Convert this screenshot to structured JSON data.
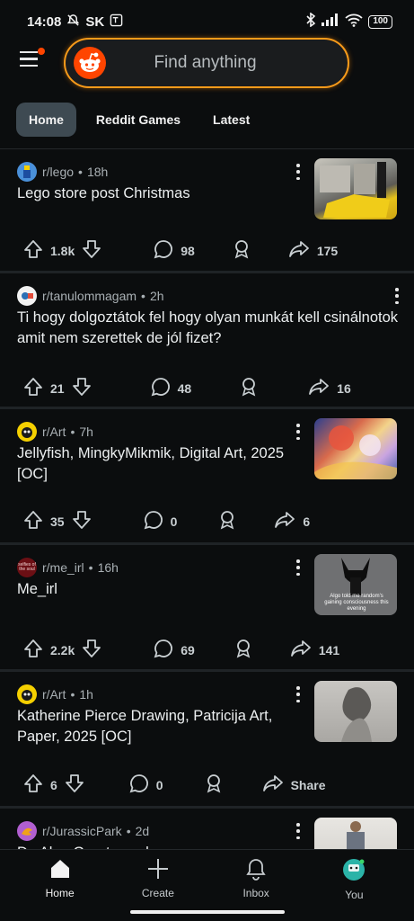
{
  "status": {
    "time": "14:08",
    "carrier": "SK",
    "battery": "100"
  },
  "search": {
    "placeholder": "Find anything"
  },
  "tabs": [
    "Home",
    "Reddit Games",
    "Latest"
  ],
  "posts": [
    {
      "subreddit": "r/lego",
      "age": "18h",
      "title": "Lego store post Christmas",
      "up": "1.8k",
      "comments": "98",
      "shares": "175"
    },
    {
      "subreddit": "r/tanulommagam",
      "age": "2h",
      "title": "Ti hogy dolgoztátok fel hogy olyan munkát kell csinálnotok amit nem szerettek de jól fizet?",
      "up": "21",
      "comments": "48",
      "shares": "16"
    },
    {
      "subreddit": "r/Art",
      "age": "7h",
      "title": "Jellyfish, MingkyMikmik, Digital Art, 2025 [OC]",
      "up": "35",
      "comments": "0",
      "shares": "6"
    },
    {
      "subreddit": "r/me_irl",
      "age": "16h",
      "title": "Me_irl",
      "up": "2.2k",
      "comments": "69",
      "shares": "141",
      "thumb_caption": "Algo told me random's gaining consciousness this evening"
    },
    {
      "subreddit": "r/Art",
      "age": "1h",
      "title": "Katherine Pierce Drawing, Patricija Art, Paper, 2025 [OC]",
      "up": "6",
      "comments": "0",
      "shares": "Share"
    },
    {
      "subreddit": "r/JurassicPark",
      "age": "2d",
      "title": "Dr. Alan Grant cosplay"
    }
  ],
  "me_irl_avatar_text": "selfies of the soul",
  "nav": {
    "home": "Home",
    "create": "Create",
    "inbox": "Inbox",
    "you": "You"
  },
  "colors": {
    "accent": "#ff4500",
    "search_border": "#f79a1a",
    "tab_active": "#3e4a52",
    "background": "#0b0d0e"
  }
}
